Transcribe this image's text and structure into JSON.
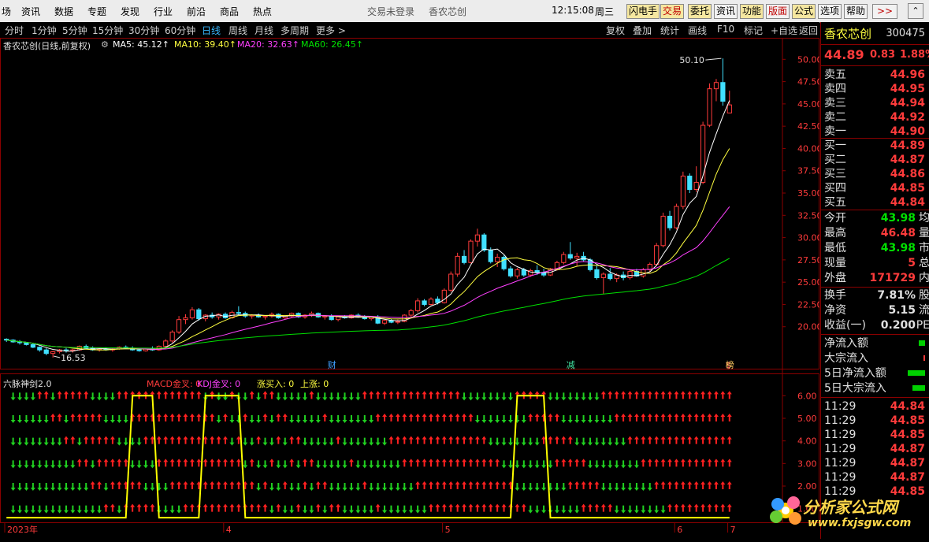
{
  "menubar": {
    "items": [
      "场",
      "资讯",
      "数据",
      "专题",
      "发现",
      "行业",
      "前沿",
      "商品",
      "热点"
    ],
    "center": [
      "交易未登录",
      "香农芯创"
    ],
    "time": "12:15:08",
    "weekday": "周三",
    "buttons": [
      "闪电手",
      "交易",
      "委托",
      "资讯",
      "功能",
      "版面",
      "公式",
      "选项",
      "帮助"
    ],
    "more": ">>"
  },
  "periodbar": {
    "periods": [
      "分时",
      "1分钟",
      "5分钟",
      "15分钟",
      "30分钟",
      "60分钟",
      "日线",
      "周线",
      "月线",
      "多周期",
      "更多 >"
    ],
    "tools": [
      "复权",
      "叠加",
      "统计",
      "画线",
      "F10",
      "标记",
      "+自选",
      "返回"
    ]
  },
  "main_info": {
    "title": "香农芯创(日线,前复权)",
    "ma5": "MA5: 45.12↑",
    "ma10": "MA10: 39.40↑",
    "ma20": "MA20: 32.63↑",
    "ma60": "MA60: 26.45↑",
    "high_label": "50.10",
    "low_label": "16.53",
    "markers": [
      "财",
      "减",
      "$",
      "榜"
    ]
  },
  "indicator_info": {
    "title": "六脉神剑2.0",
    "macd": "MACD金叉: 0",
    "kdj": "KDJ金叉: 0",
    "zmr": "涨买入: 0",
    "up": "上涨: 0"
  },
  "dates": [
    "2023年",
    "4",
    "5",
    "6",
    "7"
  ],
  "colors": {
    "up": "#ff3b3b",
    "down": "#40e0ff",
    "ma5": "#ffffff",
    "ma10": "#ffff40",
    "ma20": "#ff40ff",
    "ma60": "#00e000",
    "signal": "#ffff00",
    "arrow_up": "#ff2020",
    "arrow_down": "#20d020"
  },
  "right_panel": {
    "name": "香农芯创",
    "code": "300475",
    "price": "44.89",
    "change": "0.83",
    "pct": "1.88%",
    "asks": [
      {
        "label": "卖五",
        "price": "44.96"
      },
      {
        "label": "卖四",
        "price": "44.95"
      },
      {
        "label": "卖三",
        "price": "44.94"
      },
      {
        "label": "卖二",
        "price": "44.92"
      },
      {
        "label": "卖一",
        "price": "44.90"
      }
    ],
    "bids": [
      {
        "label": "买一",
        "price": "44.89"
      },
      {
        "label": "买二",
        "price": "44.87"
      },
      {
        "label": "买三",
        "price": "44.86"
      },
      {
        "label": "买四",
        "price": "44.85"
      },
      {
        "label": "买五",
        "price": "44.84"
      }
    ],
    "stats": [
      {
        "label": "今开",
        "value": "43.98",
        "cls": "green",
        "tail": "均"
      },
      {
        "label": "最高",
        "value": "46.48",
        "cls": "red",
        "tail": "量"
      },
      {
        "label": "最低",
        "value": "43.98",
        "cls": "green",
        "tail": "市"
      },
      {
        "label": "现量",
        "value": "5",
        "cls": "red",
        "tail": "总"
      },
      {
        "label": "外盘",
        "value": "171729",
        "cls": "red",
        "tail": "内"
      }
    ],
    "stats2": [
      {
        "label": "换手",
        "value": "7.81%",
        "tail": "股"
      },
      {
        "label": "净资",
        "value": "5.15",
        "tail": "流"
      },
      {
        "label": "收益(一)",
        "value": "0.200",
        "tail": "PE"
      }
    ],
    "flows": [
      "净流入额",
      "大宗流入",
      "5日净流入额",
      "5日大宗流入"
    ],
    "ticks": [
      {
        "time": "11:29",
        "price": "44.84"
      },
      {
        "time": "11:29",
        "price": "44.85"
      },
      {
        "time": "11:29",
        "price": "44.85"
      },
      {
        "time": "11:29",
        "price": "44.87"
      },
      {
        "time": "11:29",
        "price": "44.87"
      },
      {
        "time": "11:29",
        "price": "44.87"
      },
      {
        "time": "11:29",
        "price": "44.85"
      }
    ]
  },
  "watermark": {
    "name": "分析家公式网",
    "url": "www.fxjsgw.com"
  },
  "chart_data": [
    {
      "type": "candlestick",
      "title": "香农芯创(日线,前复权)",
      "ylim": [
        16,
        51
      ],
      "yticks": [
        20.0,
        22.5,
        25.0,
        27.5,
        30.0,
        32.5,
        35.0,
        37.5,
        40.0,
        42.5,
        45.0,
        47.5,
        50.0
      ],
      "ohlc": [
        [
          18.6,
          18.7,
          18.3,
          18.5
        ],
        [
          18.5,
          18.6,
          18.2,
          18.3
        ],
        [
          18.3,
          18.5,
          18.0,
          18.2
        ],
        [
          18.2,
          18.3,
          17.9,
          18.0
        ],
        [
          18.0,
          18.1,
          17.6,
          17.7
        ],
        [
          17.7,
          17.8,
          17.2,
          17.4
        ],
        [
          17.4,
          17.6,
          16.8,
          17.0
        ],
        [
          17.0,
          17.3,
          16.53,
          17.2
        ],
        [
          17.2,
          17.5,
          17.0,
          17.4
        ],
        [
          17.4,
          17.6,
          17.1,
          17.3
        ],
        [
          17.3,
          17.5,
          17.1,
          17.4
        ],
        [
          17.4,
          17.9,
          17.3,
          17.8
        ],
        [
          17.8,
          18.0,
          17.5,
          17.6
        ],
        [
          17.6,
          17.8,
          17.3,
          17.4
        ],
        [
          17.4,
          17.6,
          17.2,
          17.5
        ],
        [
          17.5,
          17.7,
          17.3,
          17.4
        ],
        [
          17.4,
          17.6,
          17.2,
          17.5
        ],
        [
          17.5,
          17.8,
          17.4,
          17.7
        ],
        [
          17.7,
          17.9,
          17.5,
          17.6
        ],
        [
          17.6,
          17.8,
          17.3,
          17.4
        ],
        [
          17.4,
          17.6,
          17.2,
          17.3
        ],
        [
          17.3,
          17.6,
          17.2,
          17.5
        ],
        [
          17.5,
          17.8,
          17.3,
          17.4
        ],
        [
          17.4,
          17.9,
          17.3,
          17.8
        ],
        [
          17.8,
          18.6,
          17.7,
          18.4
        ],
        [
          18.4,
          19.6,
          18.2,
          19.4
        ],
        [
          19.4,
          21.2,
          19.2,
          20.8
        ],
        [
          20.8,
          21.4,
          20.3,
          21.0
        ],
        [
          21.0,
          22.2,
          20.8,
          21.9
        ],
        [
          21.9,
          22.1,
          20.7,
          20.9
        ],
        [
          20.9,
          21.4,
          20.6,
          21.3
        ],
        [
          21.3,
          21.6,
          20.9,
          21.1
        ],
        [
          21.1,
          21.5,
          20.8,
          21.4
        ],
        [
          21.4,
          21.6,
          20.9,
          21.0
        ],
        [
          21.0,
          21.8,
          20.9,
          21.6
        ],
        [
          21.6,
          22.3,
          21.3,
          21.5
        ],
        [
          21.5,
          21.7,
          21.0,
          21.2
        ],
        [
          21.2,
          21.4,
          20.9,
          21.3
        ],
        [
          21.3,
          21.5,
          21.0,
          21.1
        ],
        [
          21.1,
          21.3,
          20.8,
          21.2
        ],
        [
          21.2,
          21.6,
          21.0,
          21.4
        ],
        [
          21.4,
          21.5,
          20.9,
          21.0
        ],
        [
          21.0,
          21.3,
          20.8,
          21.2
        ],
        [
          21.2,
          21.6,
          21.0,
          21.5
        ],
        [
          21.5,
          21.6,
          21.0,
          21.1
        ],
        [
          21.1,
          21.4,
          20.9,
          21.3
        ],
        [
          21.3,
          21.7,
          21.1,
          21.5
        ],
        [
          21.5,
          21.6,
          21.0,
          21.1
        ],
        [
          21.1,
          21.3,
          20.8,
          21.2
        ],
        [
          21.2,
          21.4,
          20.7,
          20.8
        ],
        [
          20.8,
          21.2,
          20.6,
          21.1
        ],
        [
          21.1,
          21.3,
          20.9,
          21.0
        ],
        [
          21.0,
          21.4,
          20.9,
          21.3
        ],
        [
          21.3,
          21.5,
          21.0,
          21.1
        ],
        [
          21.1,
          21.3,
          20.8,
          20.9
        ],
        [
          20.9,
          21.2,
          20.7,
          21.1
        ],
        [
          21.1,
          21.3,
          20.3,
          20.4
        ],
        [
          20.4,
          20.8,
          20.2,
          20.7
        ],
        [
          20.7,
          20.9,
          20.4,
          20.5
        ],
        [
          20.5,
          20.8,
          20.3,
          20.6
        ],
        [
          20.6,
          21.4,
          20.5,
          21.3
        ],
        [
          21.3,
          22.0,
          21.1,
          21.8
        ],
        [
          21.8,
          23.2,
          21.6,
          22.9
        ],
        [
          22.9,
          23.1,
          22.3,
          22.5
        ],
        [
          22.5,
          23.3,
          22.4,
          23.1
        ],
        [
          23.1,
          23.4,
          22.5,
          22.7
        ],
        [
          22.7,
          24.3,
          22.6,
          24.1
        ],
        [
          24.1,
          26.2,
          23.9,
          25.9
        ],
        [
          25.9,
          28.3,
          25.6,
          27.9
        ],
        [
          27.9,
          28.6,
          27.0,
          27.2
        ],
        [
          27.2,
          29.8,
          27.1,
          29.6
        ],
        [
          29.6,
          31.0,
          29.0,
          30.3
        ],
        [
          30.3,
          30.5,
          28.4,
          28.6
        ],
        [
          28.6,
          28.9,
          27.1,
          27.3
        ],
        [
          27.3,
          28.2,
          26.7,
          27.8
        ],
        [
          27.8,
          28.0,
          26.3,
          26.5
        ],
        [
          26.5,
          26.8,
          25.5,
          25.7
        ],
        [
          25.7,
          26.6,
          25.4,
          26.4
        ],
        [
          26.4,
          26.6,
          25.6,
          25.8
        ],
        [
          25.8,
          26.5,
          25.6,
          26.3
        ],
        [
          26.3,
          26.9,
          25.8,
          26.1
        ],
        [
          26.1,
          26.5,
          25.6,
          25.8
        ],
        [
          25.8,
          26.6,
          25.7,
          26.5
        ],
        [
          26.5,
          27.4,
          26.3,
          27.2
        ],
        [
          27.2,
          28.4,
          27.0,
          28.1
        ],
        [
          28.1,
          29.5,
          27.5,
          27.7
        ],
        [
          27.7,
          28.3,
          26.8,
          27.9
        ],
        [
          27.9,
          28.4,
          27.3,
          27.5
        ],
        [
          27.5,
          27.7,
          26.2,
          26.4
        ],
        [
          26.4,
          26.9,
          25.3,
          25.5
        ],
        [
          25.5,
          26.1,
          23.7,
          25.9
        ],
        [
          25.9,
          26.6,
          25.2,
          25.4
        ],
        [
          25.4,
          26.0,
          25.0,
          25.8
        ],
        [
          25.8,
          26.2,
          25.2,
          25.5
        ],
        [
          25.5,
          26.4,
          25.3,
          26.2
        ],
        [
          26.2,
          26.5,
          25.6,
          25.7
        ],
        [
          25.7,
          26.6,
          25.5,
          26.4
        ],
        [
          26.4,
          27.2,
          26.1,
          27.0
        ],
        [
          27.0,
          29.4,
          26.8,
          29.1
        ],
        [
          29.1,
          32.8,
          28.9,
          32.4
        ],
        [
          32.4,
          33.0,
          30.8,
          31.1
        ],
        [
          31.1,
          33.8,
          30.9,
          33.5
        ],
        [
          33.5,
          37.4,
          33.2,
          36.9
        ],
        [
          36.9,
          37.2,
          35.0,
          35.4
        ],
        [
          35.4,
          38.0,
          35.1,
          36.2
        ],
        [
          36.2,
          43.0,
          36.0,
          42.6
        ],
        [
          42.6,
          47.3,
          42.4,
          46.7
        ],
        [
          46.7,
          47.8,
          45.3,
          47.4
        ],
        [
          47.4,
          50.1,
          44.8,
          45.3
        ],
        [
          43.98,
          46.48,
          43.98,
          44.89
        ]
      ],
      "ma": {
        "ma5_last": 45.12,
        "ma10_last": 39.4,
        "ma20_last": 32.63,
        "ma60_last": 26.45
      }
    },
    {
      "type": "signal",
      "title": "六脉神剑2.0",
      "ylim": [
        0.5,
        6.5
      ],
      "yticks": [
        1.0,
        2.0,
        3.0,
        4.0,
        5.0,
        6.0
      ],
      "rows": 6,
      "signal_high_ranges": [
        [
          19,
          22
        ],
        [
          30,
          35
        ],
        [
          77,
          81
        ],
        [
          111,
          114
        ],
        [
          131,
          140
        ]
      ]
    }
  ]
}
